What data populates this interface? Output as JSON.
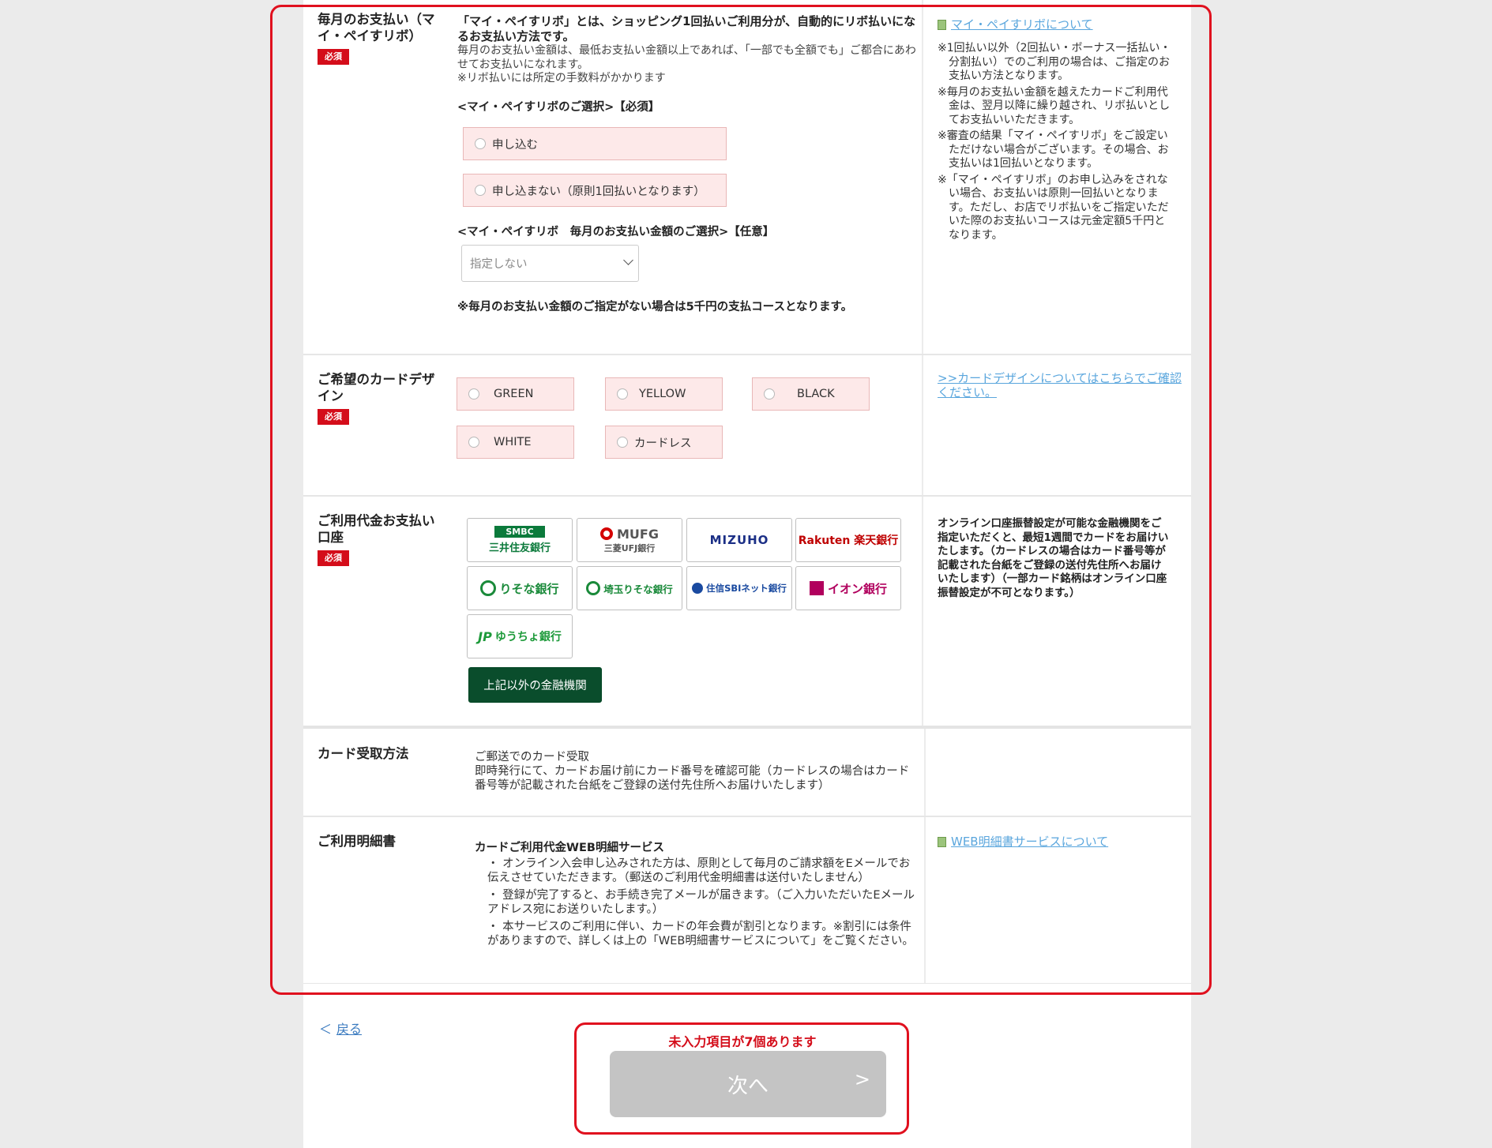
{
  "monthly": {
    "label": "毎月のお支払い（マイ・ペイすリボ）",
    "required": "必須",
    "lead": "「マイ・ペイすリボ」とは、ショッピング1回払いご利用分が、自動的にリボ払いになるお支払い方法です。",
    "desc1": "毎月のお支払い金額は、最低お支払い金額以上であれば、「一部でも全額でも」ご都合にあわせてお支払いになれます。",
    "desc2": "※リボ払いには所定の手数料がかかります",
    "select_heading": "<マイ・ペイすリボのご選択>【必須】",
    "opt_apply": "申し込む",
    "opt_noapply": "申し込まない（原則1回払いとなります）",
    "amount_heading": "<マイ・ペイすリボ　毎月のお支払い金額のご選択>【任意】",
    "amount_value": "指定しない",
    "footnote": "※毎月のお支払い金額のご指定がない場合は5千円の支払コースとなります。",
    "link": "マイ・ペイすリボについて",
    "notes": [
      "※1回払い以外（2回払い・ボーナス一括払い・分割払い）でのご利用の場合は、ご指定のお支払い方法となります。",
      "※毎月のお支払い金額を越えたカードご利用代金は、翌月以降に繰り越され、リボ払いとしてお支払いいただきます。",
      "※審査の結果「マイ・ペイすリボ」をご設定いただけない場合がございます。その場合、お支払いは1回払いとなります。",
      "※「マイ・ペイすリボ」のお申し込みをされない場合、お支払いは原則一回払いとなります。ただし、お店でリボ払いをご指定いただいた際のお支払いコースは元金定額5千円となります。"
    ]
  },
  "design": {
    "label": "ご希望のカードデザイン",
    "required": "必須",
    "options": [
      "GREEN",
      "YELLOW",
      "BLACK",
      "WHITE",
      "カードレス"
    ],
    "link": ">>カードデザインについてはこちらでご確認ください。"
  },
  "account": {
    "label": "ご利用代金お支払い口座",
    "required": "必須",
    "banks": [
      {
        "name": "三井住友銀行",
        "sub": "SMBC",
        "color": "#0b7a3b"
      },
      {
        "name": "MUFG",
        "sub": "三菱UFJ銀行",
        "color": "#d40000"
      },
      {
        "name": "MIZUHO",
        "sub": "",
        "color": "#1b2f86"
      },
      {
        "name": "Rakuten 楽天銀行",
        "sub": "",
        "color": "#bf0000"
      },
      {
        "name": "りそな銀行",
        "sub": "",
        "color": "#1a8a3a"
      },
      {
        "name": "埼玉りそな銀行",
        "sub": "",
        "color": "#1a8a3a"
      },
      {
        "name": "住信SBIネット銀行",
        "sub": "",
        "color": "#1a4aa0"
      },
      {
        "name": "イオン銀行",
        "sub": "",
        "color": "#b1005d"
      },
      {
        "name": "ゆうちょ銀行",
        "sub": "",
        "color": "#1d9a3a"
      }
    ],
    "other_button": "上記以外の金融機関",
    "notice": "オンライン口座振替設定が可能な金融機関をご指定いただくと、最短1週間でカードをお届けいたします。（カードレスの場合はカード番号等が記載された台紙をご登録の送付先住所へお届けいたします）（一部カード銘柄はオンライン口座振替設定が不可となります。）"
  },
  "receive": {
    "label": "カード受取方法",
    "line1": "ご郵送でのカード受取",
    "line2": "即時発行にて、カードお届け前にカード番号を確認可能（カードレスの場合はカード番号等が記載された台紙をご登録の送付先住所へお届けいたします）"
  },
  "statement": {
    "label": "ご利用明細書",
    "title": "カードご利用代金WEB明細サービス",
    "bullets": [
      "・ オンライン入会申し込みされた方は、原則として毎月のご請求額をEメールでお伝えさせていただきます。（郵送のご利用代金明細書は送付いたしません）",
      "・ 登録が完了すると、お手続き完了メールが届きます。（ご入力いただいたEメールアドレス宛にお送りいたします。）",
      "・ 本サービスのご利用に伴い、カードの年会費が割引となります。※割引には条件がありますので、詳しくは上の「WEB明細書サービスについて」をご覧ください。"
    ],
    "link": "WEB明細書サービスについて"
  },
  "footer": {
    "back": "戻る",
    "back_arrow": "＜",
    "missing": "未入力項目が7個あります",
    "next": "次へ",
    "next_arrow": ">"
  }
}
